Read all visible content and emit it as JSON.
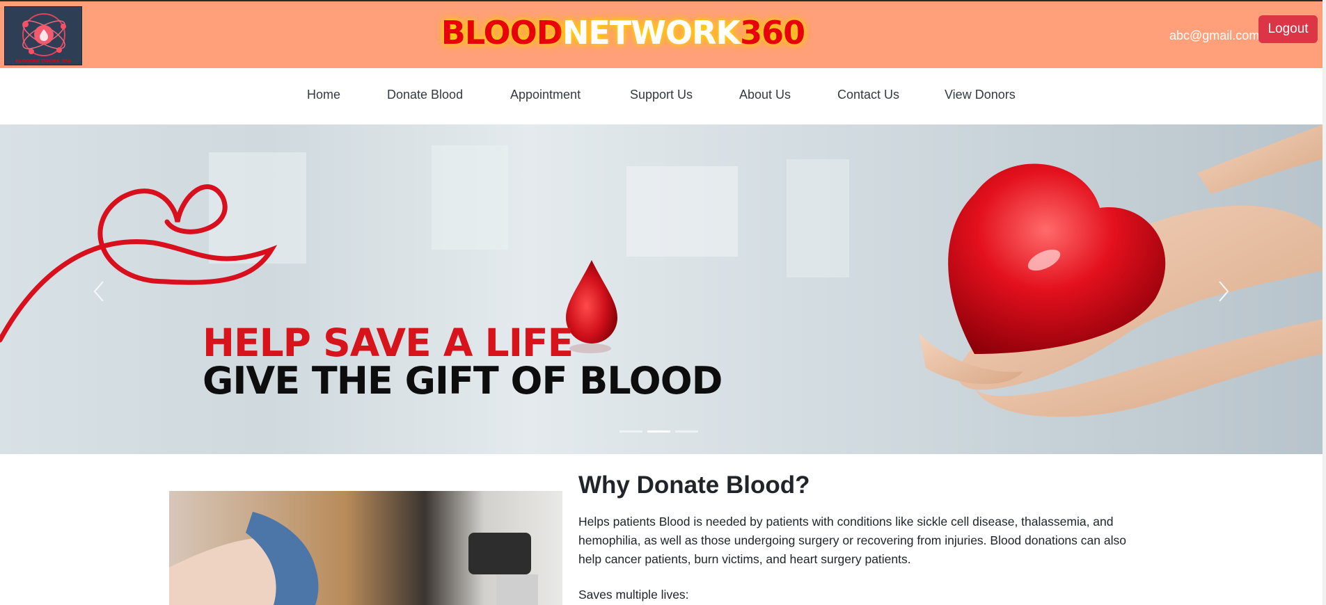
{
  "header": {
    "logo_icon": "blood-network-logo",
    "logo_caption": "BLOODNETWORK 360",
    "brand": {
      "part1": "BLOOD",
      "part2": "NETWORK",
      "part3": "360"
    },
    "user_email": "abc@gmail.com",
    "logout_label": "Logout",
    "colors": {
      "bar": "#ffa07a",
      "brand_red": "#e8000b",
      "logout_bg": "#dc3545"
    }
  },
  "nav": {
    "items": [
      {
        "label": "Home"
      },
      {
        "label": "Donate Blood"
      },
      {
        "label": "Appointment"
      },
      {
        "label": "Support Us"
      },
      {
        "label": "About Us"
      },
      {
        "label": "Contact Us"
      },
      {
        "label": "View Donors"
      }
    ]
  },
  "carousel": {
    "headline": "HELP SAVE A LIFE",
    "subheadline": "GIVE THE GIFT OF BLOOD",
    "prev_icon": "chevron-left-icon",
    "next_icon": "chevron-right-icon",
    "slide_count": 3,
    "active_slide": 2
  },
  "main": {
    "title": "Why Donate Blood?",
    "paragraph": "Helps patients Blood is needed by patients with conditions like sickle cell disease, thalassemia, and hemophilia, as well as those undergoing surgery or recovering from injuries. Blood donations can also help cancer patients, burn victims, and heart surgery patients.",
    "subheading": "Saves multiple lives:"
  }
}
